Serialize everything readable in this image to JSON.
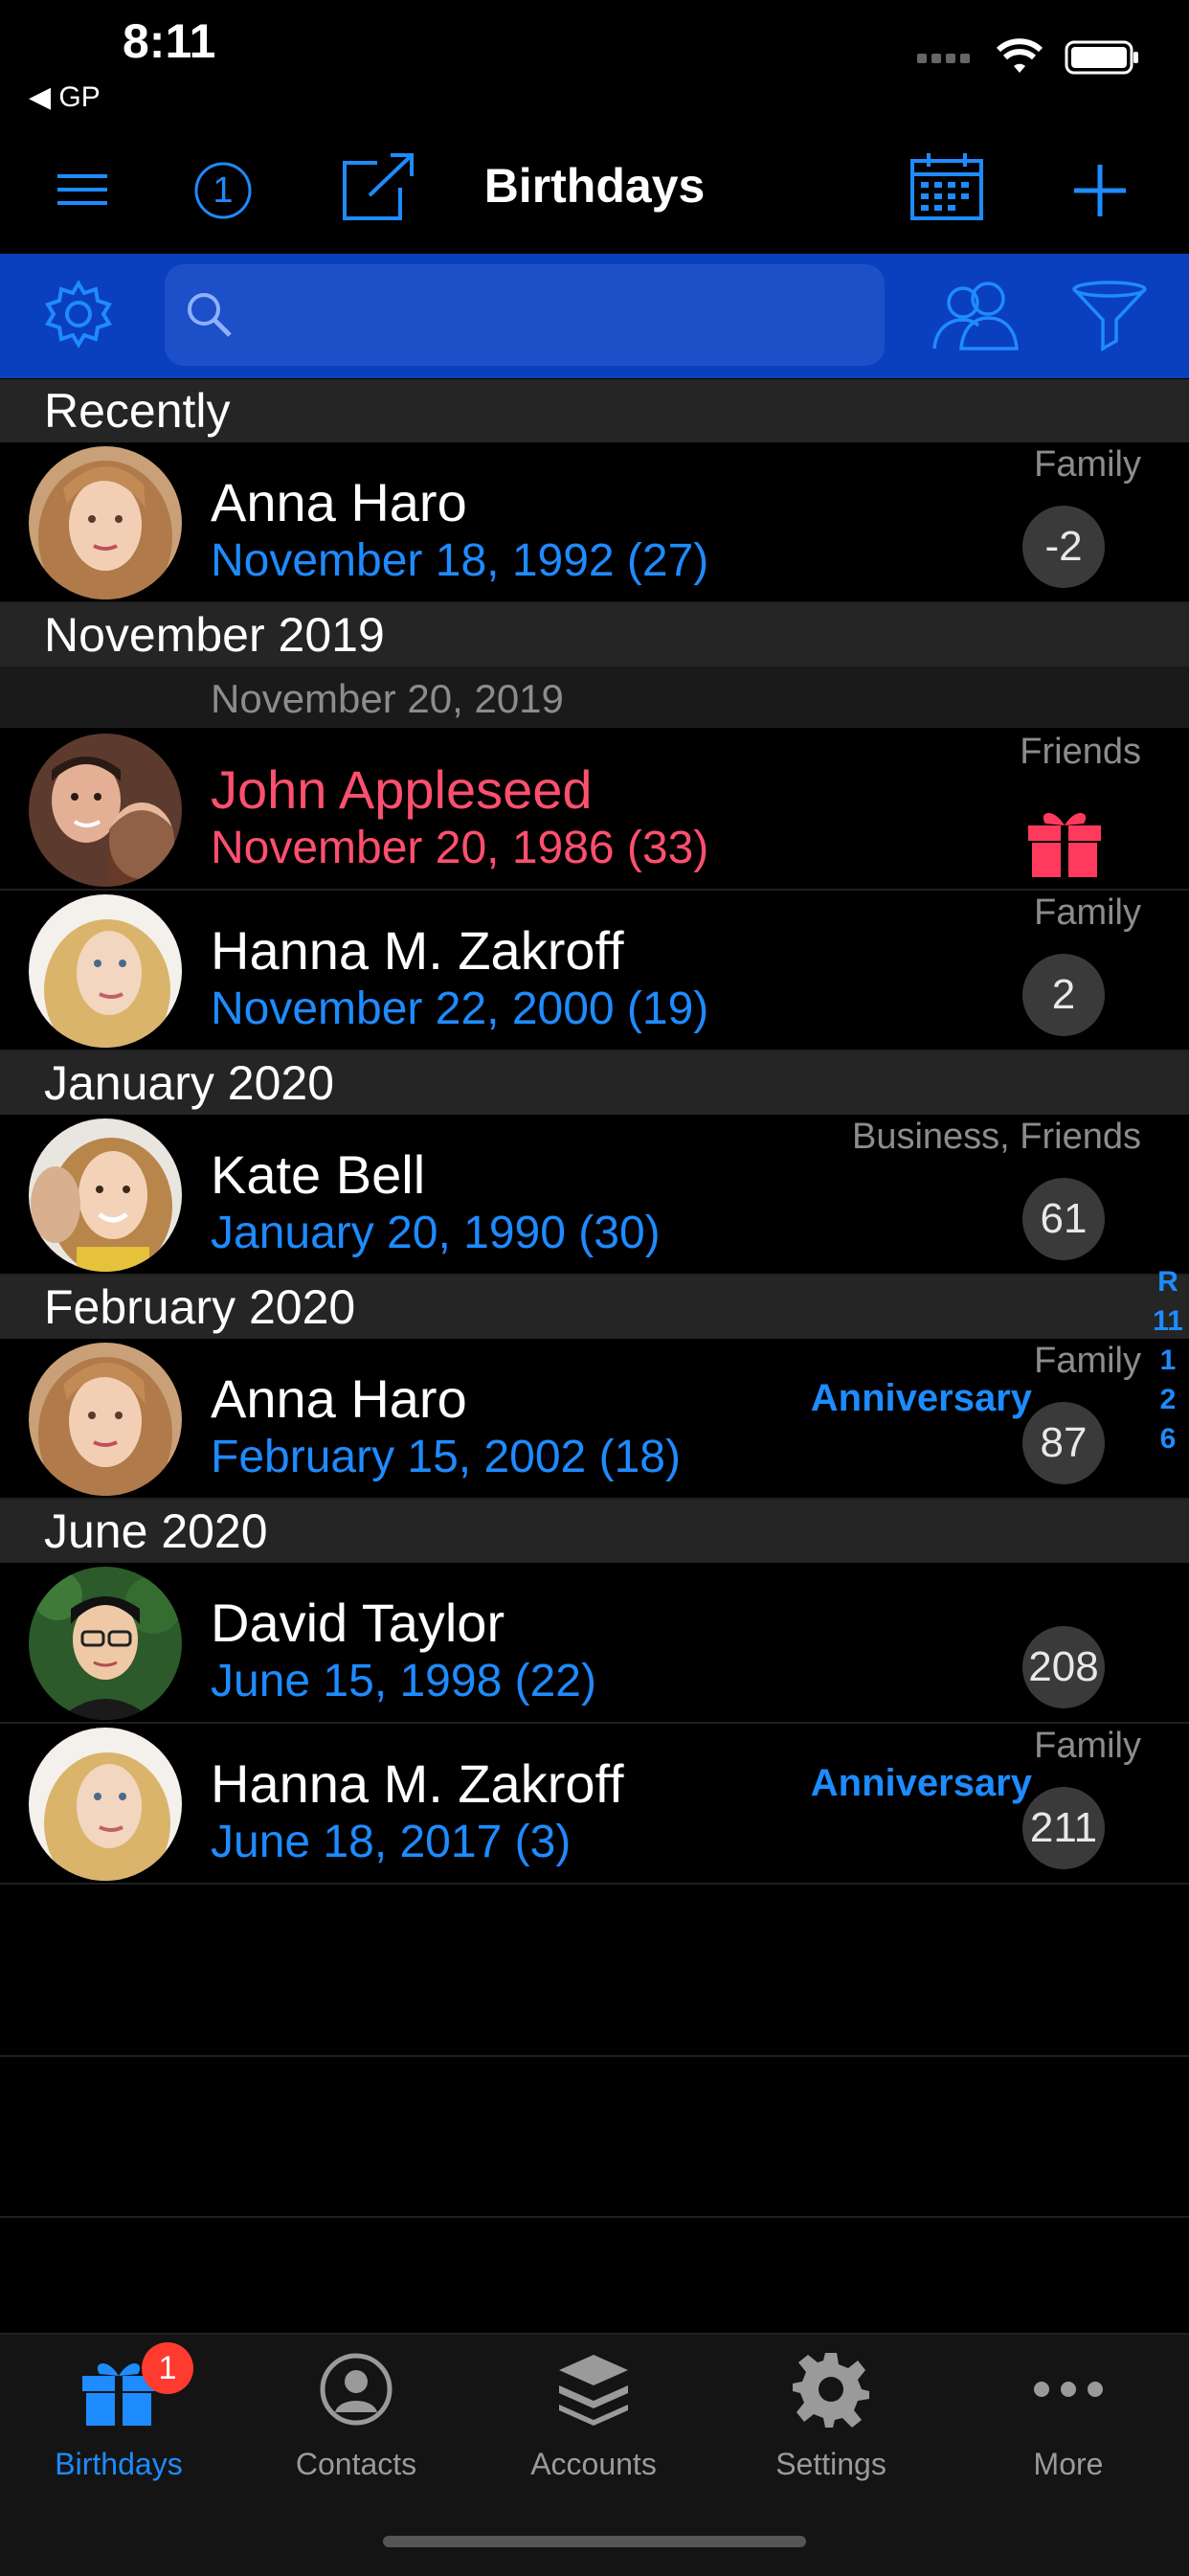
{
  "status_bar": {
    "time": "8:11",
    "back_label": "◀ GP"
  },
  "nav": {
    "title": "Birthdays",
    "badge_count": "1"
  },
  "search": {
    "placeholder": ""
  },
  "list": [
    {
      "section": "Recently"
    },
    {
      "name": "Anna Haro",
      "date": "November 18, 1992 (27)",
      "group": "Family",
      "badge": "-2",
      "anniversary": "",
      "highlight": false,
      "avatar": "anna"
    },
    {
      "section": "November 2019"
    },
    {
      "subheader": "November 20, 2019"
    },
    {
      "name": "John Appleseed",
      "date": "November 20, 1986 (33)",
      "group": "Friends",
      "badge": "",
      "gift": true,
      "anniversary": "",
      "highlight": true,
      "avatar": "john"
    },
    {
      "name": "Hanna M. Zakroff",
      "date": "November 22, 2000 (19)",
      "group": "Family",
      "badge": "2",
      "anniversary": "",
      "highlight": false,
      "avatar": "hanna"
    },
    {
      "section": "January 2020"
    },
    {
      "name": "Kate Bell",
      "date": "January 20, 1990 (30)",
      "group": "Business, Friends",
      "badge": "61",
      "anniversary": "",
      "highlight": false,
      "avatar": "kate"
    },
    {
      "section": "February 2020"
    },
    {
      "name": "Anna Haro",
      "date": "February 15, 2002 (18)",
      "group": "Family",
      "badge": "87",
      "anniversary": "Anniversary",
      "highlight": false,
      "avatar": "anna"
    },
    {
      "section": "June 2020"
    },
    {
      "name": "David Taylor",
      "date": "June 15, 1998 (22)",
      "group": "",
      "badge": "208",
      "anniversary": "",
      "highlight": false,
      "avatar": "david"
    },
    {
      "name": "Hanna M. Zakroff",
      "date": "June 18, 2017 (3)",
      "group": "Family",
      "badge": "211",
      "anniversary": "Anniversary",
      "highlight": false,
      "avatar": "hanna"
    }
  ],
  "section_index": [
    "R",
    "11",
    "1",
    "2",
    "6"
  ],
  "tabs": [
    {
      "label": "Birthdays",
      "icon": "gift-icon",
      "active": true,
      "badge": "1"
    },
    {
      "label": "Contacts",
      "icon": "person-icon",
      "active": false
    },
    {
      "label": "Accounts",
      "icon": "layers-icon",
      "active": false
    },
    {
      "label": "Settings",
      "icon": "gear-icon",
      "active": false
    },
    {
      "label": "More",
      "icon": "ellipsis-icon",
      "active": false
    }
  ],
  "colors": {
    "accent": "#1e8bff",
    "toolbar": "#0a3fbd",
    "highlight": "#ff4f6f"
  }
}
